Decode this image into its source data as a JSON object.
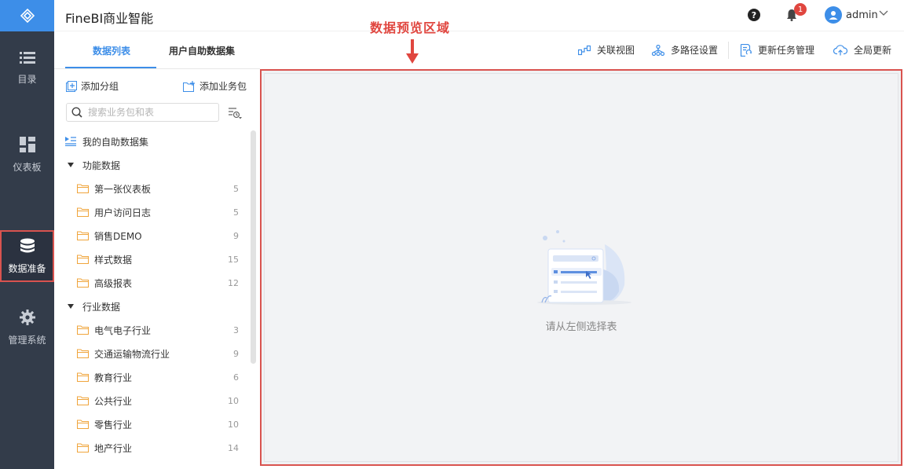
{
  "app": {
    "title": "FineBI商业智能"
  },
  "nav": {
    "items": [
      {
        "label": "目录",
        "icon": "list-icon"
      },
      {
        "label": "仪表板",
        "icon": "dashboard-icon"
      },
      {
        "label": "数据准备",
        "icon": "database-icon",
        "active": true
      },
      {
        "label": "管理系统",
        "icon": "gear-icon"
      }
    ]
  },
  "header": {
    "help": "?",
    "notification_count": "1",
    "user": "admin"
  },
  "panel": {
    "tabs": [
      "数据列表",
      "用户自助数据集"
    ],
    "add_group": "添加分组",
    "add_package": "添加业务包",
    "search_placeholder": "搜索业务包和表",
    "my_datasets": "我的自助数据集",
    "groups": [
      {
        "label": "功能数据",
        "items": [
          {
            "label": "第一张仪表板",
            "count": "5"
          },
          {
            "label": "用户访问日志",
            "count": "5"
          },
          {
            "label": "销售DEMO",
            "count": "9"
          },
          {
            "label": "样式数据",
            "count": "15"
          },
          {
            "label": "高级报表",
            "count": "12"
          }
        ]
      },
      {
        "label": "行业数据",
        "items": [
          {
            "label": "电气电子行业",
            "count": "3"
          },
          {
            "label": "交通运输物流行业",
            "count": "9"
          },
          {
            "label": "教育行业",
            "count": "6"
          },
          {
            "label": "公共行业",
            "count": "10"
          },
          {
            "label": "零售行业",
            "count": "10"
          },
          {
            "label": "地产行业",
            "count": "14"
          }
        ]
      }
    ]
  },
  "toolbar": {
    "relation_view": "关联视图",
    "multipath": "多路径设置",
    "update_tasks": "更新任务管理",
    "global_update": "全局更新"
  },
  "preview": {
    "empty_text": "请从左侧选择表"
  },
  "annotation": {
    "label": "数据预览区域"
  },
  "colors": {
    "accent": "#3d8ee8",
    "nav_bg": "#333c4a",
    "highlight": "#d9534f",
    "folder": "#f0a53c"
  }
}
